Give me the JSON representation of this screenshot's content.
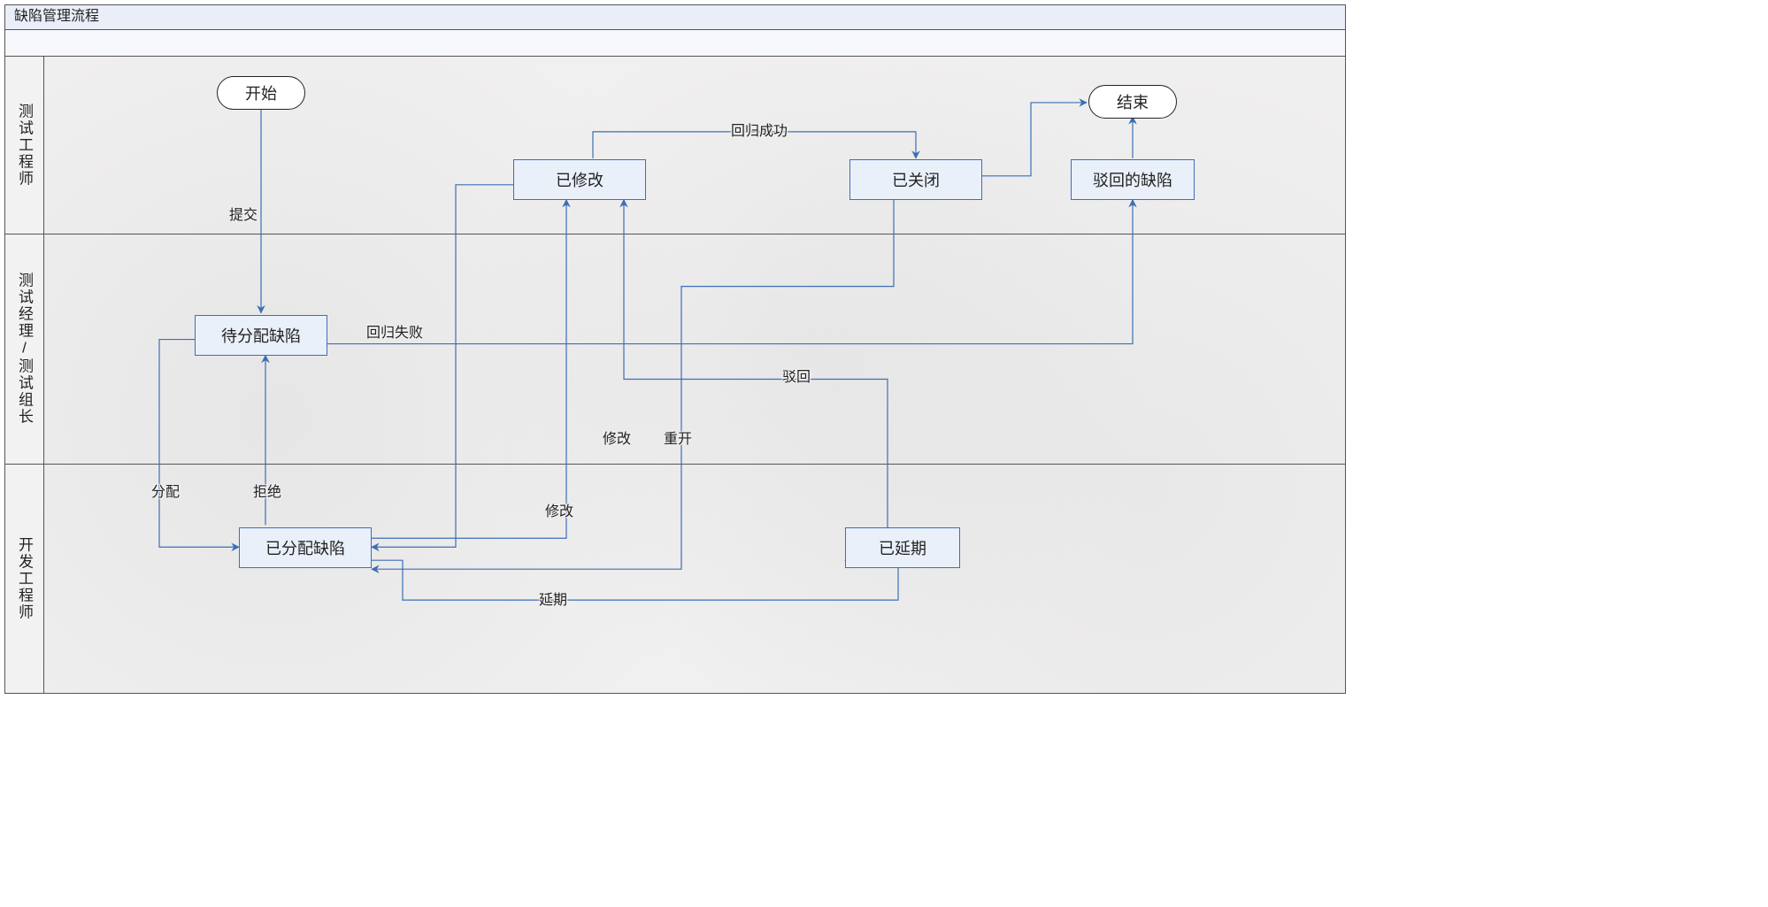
{
  "title": "缺陷管理流程",
  "lanes": {
    "lane1": "测试工程师",
    "lane2": "测试经理/测试组长",
    "lane3": "开发工程师"
  },
  "nodes": {
    "start": "开始",
    "end": "结束",
    "pending": "待分配缺陷",
    "assigned": "已分配缺陷",
    "modified": "已修改",
    "closed": "已关闭",
    "rejected": "驳回的缺陷",
    "delayed": "已延期"
  },
  "edges": {
    "submit": "提交",
    "assign": "分配",
    "refuse": "拒绝",
    "reg_fail": "回归失败",
    "modify1": "修改",
    "modify2": "修改",
    "delay": "延期",
    "reopen": "重开",
    "reg_ok": "回归成功",
    "reject": "驳回"
  },
  "colors": {
    "node_fill": "#eaf0fa",
    "node_border": "#3b6fb6",
    "edge": "#3b6fb6"
  }
}
